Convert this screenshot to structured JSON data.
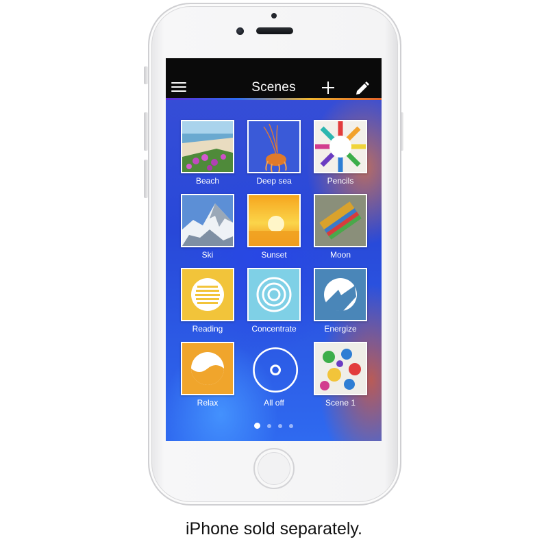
{
  "header": {
    "title": "Scenes",
    "menu_icon": "hamburger-menu-icon",
    "add_icon": "plus-icon",
    "edit_icon": "pencil-icon"
  },
  "scenes": [
    {
      "label": "Beach",
      "icon": "beach-photo"
    },
    {
      "label": "Deep sea",
      "icon": "jellyfish-photo"
    },
    {
      "label": "Pencils",
      "icon": "pencils-photo"
    },
    {
      "label": "Ski",
      "icon": "mountain-photo"
    },
    {
      "label": "Sunset",
      "icon": "sunset-photo"
    },
    {
      "label": "Moon",
      "icon": "socks-photo"
    },
    {
      "label": "Reading",
      "icon": "reading-icon",
      "color": "#f2c43a"
    },
    {
      "label": "Concentrate",
      "icon": "concentrate-icon",
      "color": "#7fd0e6"
    },
    {
      "label": "Energize",
      "icon": "energize-icon",
      "color": "#4a86b8"
    },
    {
      "label": "Relax",
      "icon": "relax-icon",
      "color": "#f0a52c"
    },
    {
      "label": "All off",
      "icon": "power-off-icon"
    },
    {
      "label": "Scene 1",
      "icon": "handprints-photo"
    }
  ],
  "pagination": {
    "pages": 4,
    "active": 1
  },
  "caption": "iPhone sold separately.",
  "colors": {
    "navbar": "#0a0a0a",
    "tile_border": "#ffffff",
    "label_text": "#ffffff"
  }
}
